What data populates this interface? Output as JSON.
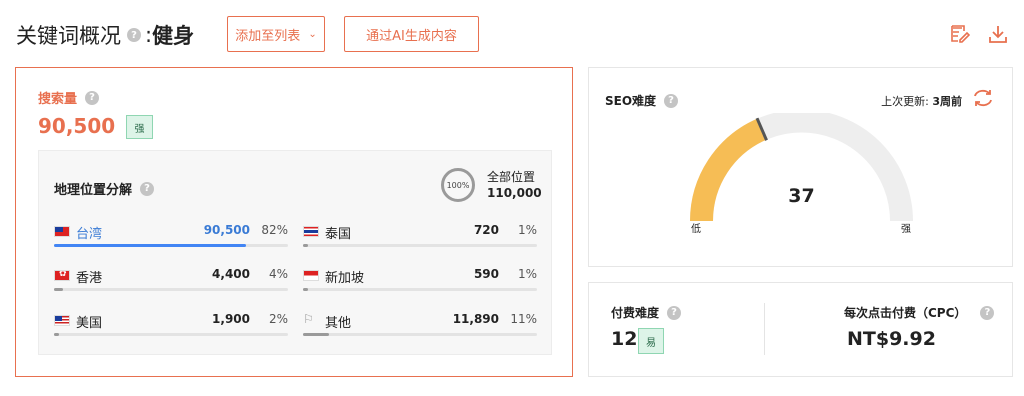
{
  "header": {
    "title_prefix": "关键词概况",
    "keyword": "健身",
    "add_to_list_label": "添加至列表",
    "ai_generate_label": "通过AI生成内容",
    "icons": [
      "edit-report-icon",
      "download-icon"
    ]
  },
  "search_volume": {
    "label": "搜索量",
    "value": "90,500",
    "badge": "强"
  },
  "geo": {
    "title": "地理位置分解",
    "all_circle": "100%",
    "all_label": "全部位置",
    "all_value": "110,000",
    "rows": [
      {
        "flag": "tw-flag-icon",
        "name": "台湾",
        "value": "90,500",
        "pct": "82%",
        "share": 0.82,
        "highlight": true
      },
      {
        "flag": "th-flag-icon",
        "name": "泰国",
        "value": "720",
        "pct": "1%",
        "share": 0.01,
        "highlight": false
      },
      {
        "flag": "hk-flag-icon",
        "name": "香港",
        "value": "4,400",
        "pct": "4%",
        "share": 0.04,
        "highlight": false
      },
      {
        "flag": "sg-flag-icon",
        "name": "新加坡",
        "value": "590",
        "pct": "1%",
        "share": 0.01,
        "highlight": false
      },
      {
        "flag": "us-flag-icon",
        "name": "美国",
        "value": "1,900",
        "pct": "2%",
        "share": 0.02,
        "highlight": false
      },
      {
        "flag": "other-flag-icon",
        "name": "其他",
        "value": "11,890",
        "pct": "11%",
        "share": 0.11,
        "highlight": false
      }
    ]
  },
  "seo": {
    "title": "SEO难度",
    "updated_label": "上次更新: ",
    "updated_value": "3周前",
    "value": "37",
    "level": 0.37,
    "low_label": "低",
    "high_label": "强",
    "fill_color": "#f6bd55",
    "track_color": "#eeeeee"
  },
  "ppc": {
    "title": "付费难度",
    "value": "12",
    "badge": "易",
    "cpc_title": "每次点击付费（CPC）",
    "cpc_value": "NT$9.92"
  },
  "colors": {
    "accent": "#e8704f",
    "highlight_blue": "#4285f4",
    "badge_green": "#ddf4e8"
  }
}
